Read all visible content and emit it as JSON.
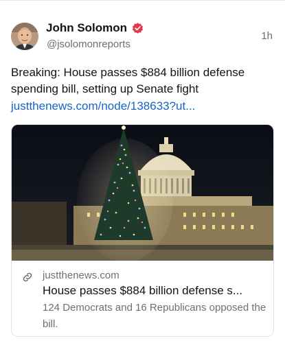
{
  "post": {
    "author_name": "John Solomon",
    "handle": "@jsolomonreports",
    "timestamp": "1h",
    "text": "Breaking: House passes $884 billion defense spending bill, setting up Senate fight",
    "link_text": "justthenews.com/node/138633?ut..."
  },
  "card": {
    "domain": "justthenews.com",
    "title": "House passes $884 billion defense s...",
    "description": "124 Democrats and 16 Republicans opposed the bill."
  },
  "icons": {
    "verified": "verified-badge-icon",
    "link": "link-icon"
  },
  "colors": {
    "link": "#1663c4",
    "verified_badge": "#e4364d",
    "secondary_text": "#687077"
  }
}
